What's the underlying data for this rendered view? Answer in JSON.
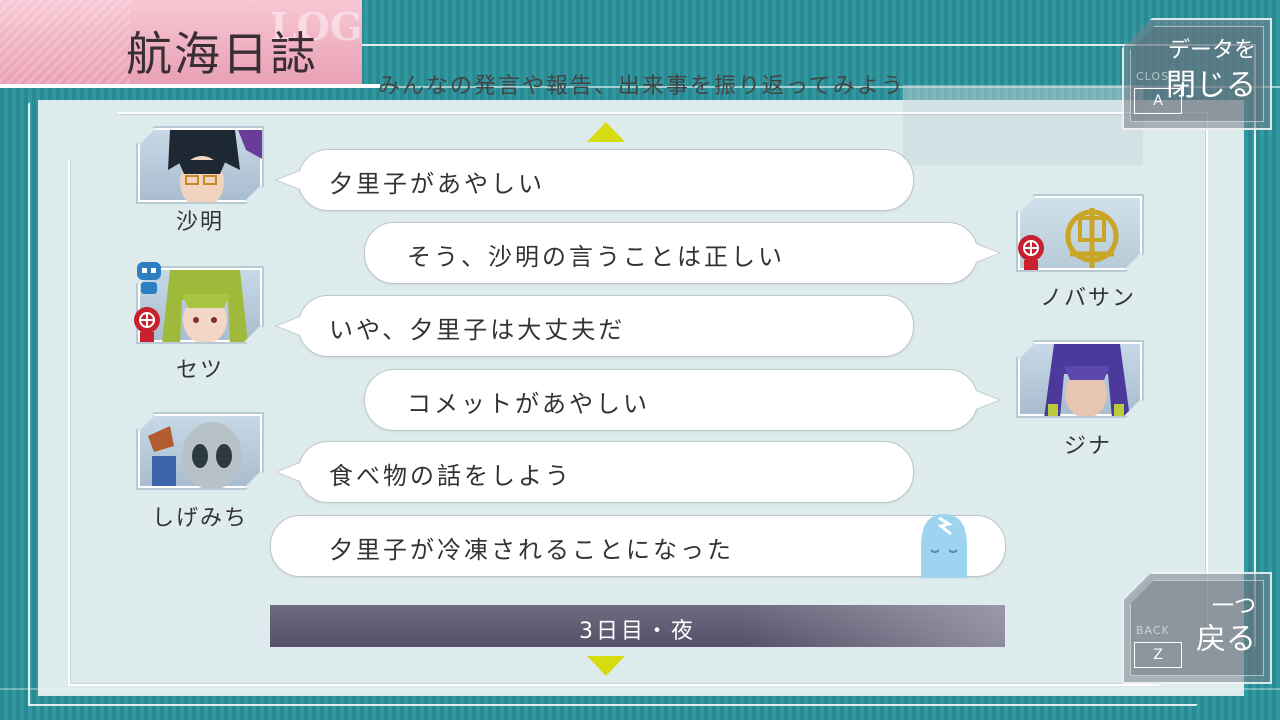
{
  "screen": {
    "title": "航海日誌",
    "title_watermark": "LOG",
    "subtitle": "みんなの発言や報告、出来事を振り返ってみよう",
    "accent_color": "#d6dc10",
    "title_tab_color": "#eaa3b7"
  },
  "close_button": {
    "small_label": "CLOSE",
    "line1": "データを",
    "line2": "閉じる",
    "key": "A"
  },
  "back_button": {
    "small_label": "BACK",
    "line1": "一つ",
    "line2": "戻る",
    "key": "Z"
  },
  "log_entries": [
    {
      "speaker": "沙明",
      "side": "left",
      "text": "夕里子があやしい"
    },
    {
      "speaker": "ノバサン",
      "side": "right",
      "text": "そう、沙明の言うことは正しい"
    },
    {
      "speaker": "セツ",
      "side": "left",
      "text": "いや、夕里子は大丈夫だ"
    },
    {
      "speaker": "ジナ",
      "side": "right",
      "text": "コメットがあやしい"
    },
    {
      "speaker": "しげみち",
      "side": "left",
      "text": "食べ物の話をしよう"
    },
    {
      "speaker": "",
      "side": "system",
      "text": "夕里子が冷凍されることになった",
      "icon": "frozen-head-icon"
    }
  ],
  "phase_label": "3日目・夜",
  "icons": {
    "scroll_up": "triangle-up-icon",
    "scroll_down": "triangle-down-icon",
    "role_badge": "red-skull-badge-icon",
    "engineer_badge": "blue-robot-badge-icon"
  }
}
